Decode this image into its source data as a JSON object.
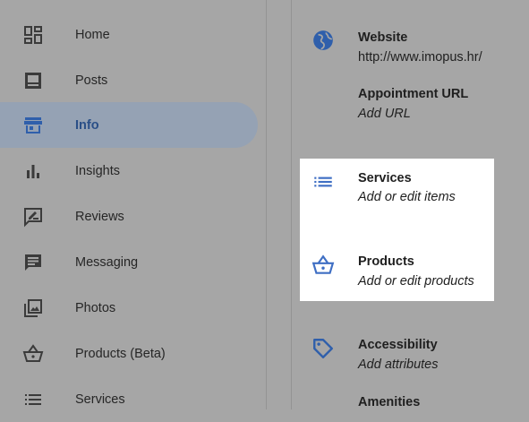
{
  "sidebar": {
    "items": [
      {
        "label": "Home",
        "icon": "dashboard-icon"
      },
      {
        "label": "Posts",
        "icon": "posts-icon"
      },
      {
        "label": "Info",
        "icon": "storefront-icon",
        "active": true
      },
      {
        "label": "Insights",
        "icon": "bar-chart-icon"
      },
      {
        "label": "Reviews",
        "icon": "reviews-icon"
      },
      {
        "label": "Messaging",
        "icon": "message-icon"
      },
      {
        "label": "Photos",
        "icon": "photos-icon"
      },
      {
        "label": "Products (Beta)",
        "icon": "basket-icon"
      },
      {
        "label": "Services",
        "icon": "list-icon"
      }
    ]
  },
  "info": {
    "website": {
      "title": "Website",
      "value": "http://www.imopus.hr/"
    },
    "appointment": {
      "title": "Appointment URL",
      "value": "Add URL"
    },
    "services": {
      "title": "Services",
      "value": "Add or edit items"
    },
    "products": {
      "title": "Products",
      "value": "Add or edit products"
    },
    "accessibility": {
      "title": "Accessibility",
      "value": "Add attributes"
    },
    "amenities": {
      "title": "Amenities"
    }
  },
  "colors": {
    "accent": "#2a4f87",
    "icon_blue": "#3f6fc4",
    "background_dim": "#a6a6a6",
    "highlight": "#ffffff"
  }
}
